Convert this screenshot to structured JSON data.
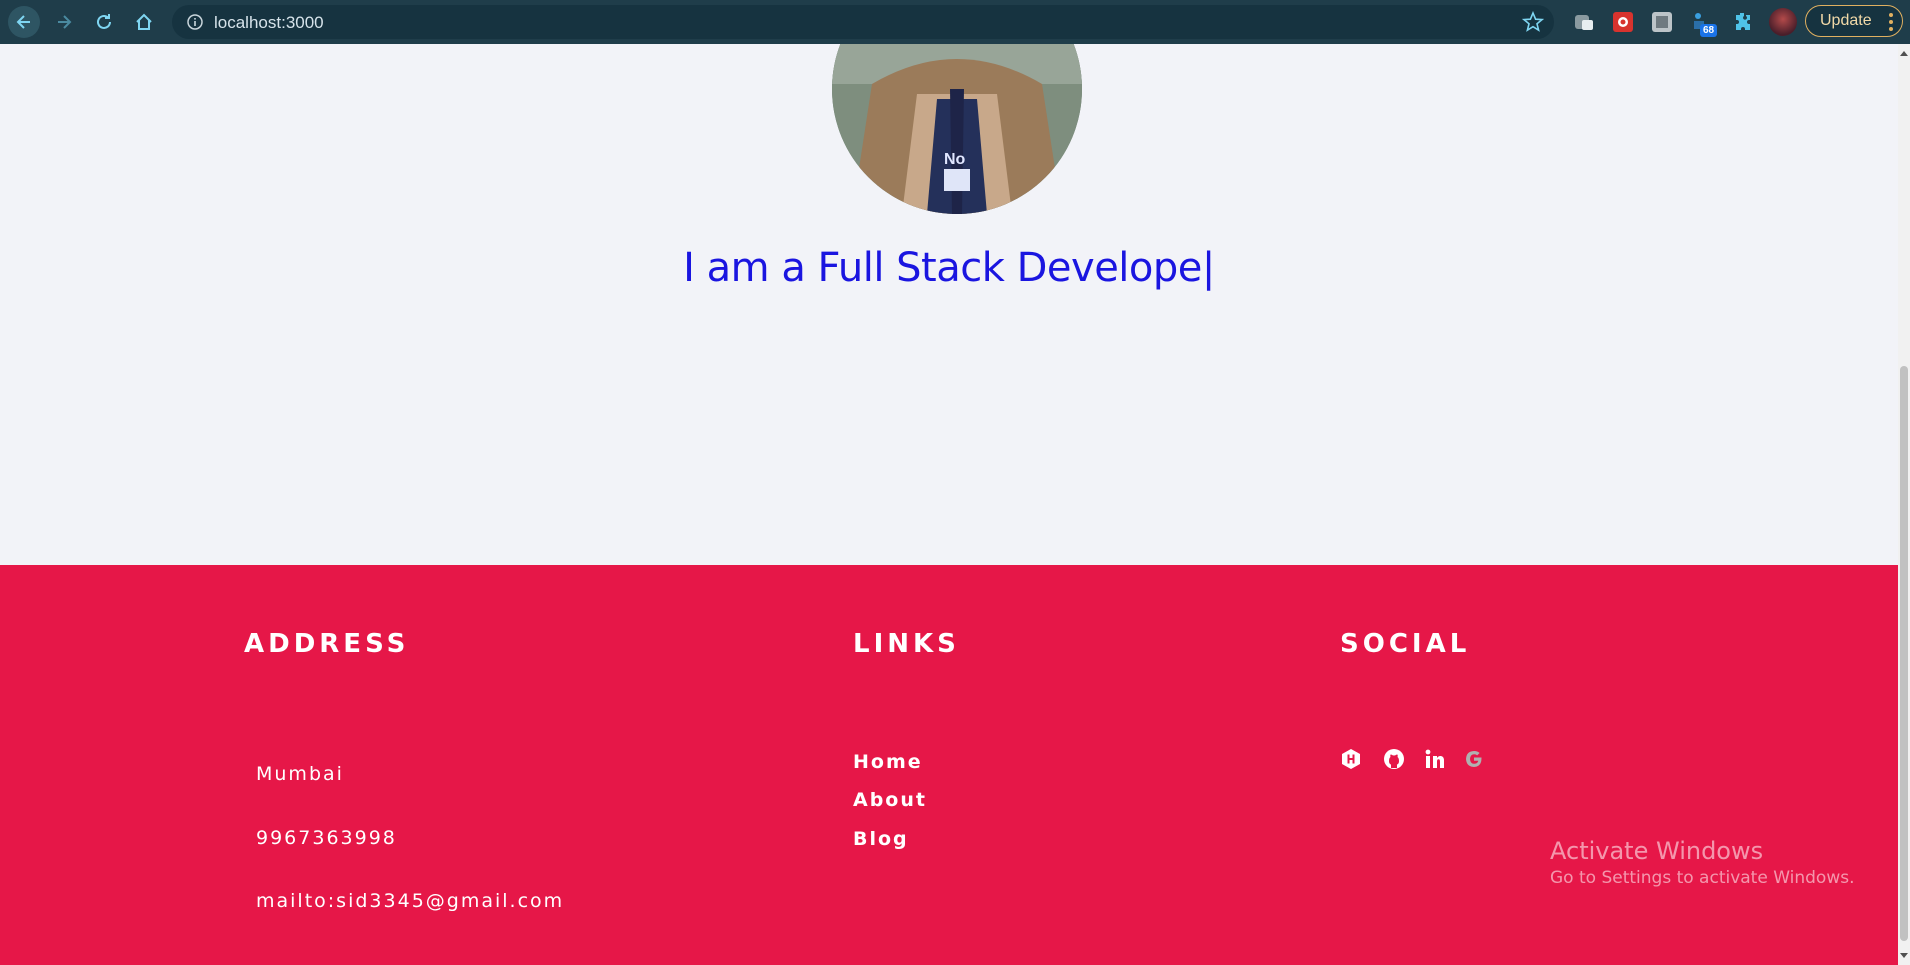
{
  "browser": {
    "url": "localhost:3000",
    "extension_badge": "68",
    "update_label": "Update",
    "colors": {
      "toolbar": "#1f3d4a",
      "omnibox": "#163340",
      "accent": "#4fc3e8"
    }
  },
  "hero": {
    "typed_text": "I am a Full Stack Develope",
    "caret": "|",
    "text_color": "#1a15e0"
  },
  "footer": {
    "background": "#e61748",
    "address": {
      "heading": "ADDRESS",
      "city": "Mumbai",
      "phone": "9967363998",
      "email": "mailto:sid3345@gmail.com"
    },
    "links": {
      "heading": "LINKS",
      "items": [
        "Home",
        "About",
        "Blog"
      ]
    },
    "social": {
      "heading": "SOCIAL",
      "icons": [
        "hackerrank-icon",
        "github-icon",
        "linkedin-icon",
        "google-icon"
      ]
    }
  },
  "watermark": {
    "title": "Activate Windows",
    "subtitle": "Go to Settings to activate Windows."
  }
}
